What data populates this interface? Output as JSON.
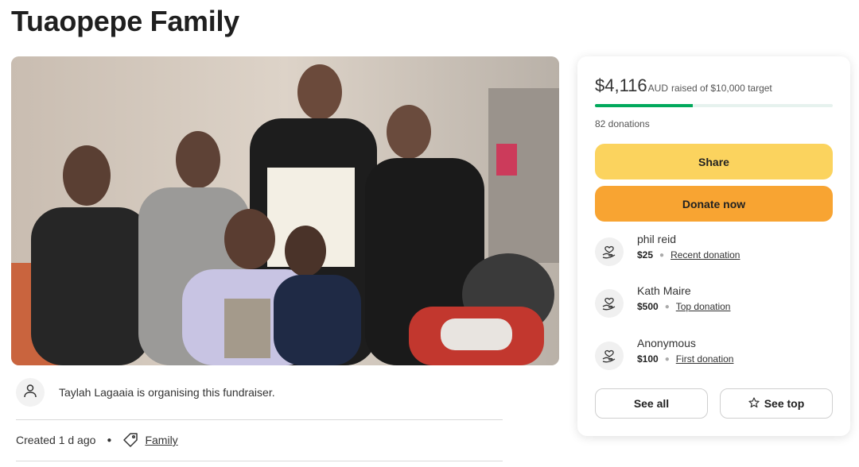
{
  "page": {
    "title": "Tuaopepe Family"
  },
  "organiser": {
    "text": "Taylah Lagaaia is organising this fundraiser."
  },
  "meta": {
    "created": "Created 1 d ago",
    "category": "Family"
  },
  "card": {
    "amount": "$4,116",
    "currency": "AUD",
    "target_text": "raised of $10,000 target",
    "progress_fraction": 0.41,
    "donations_count": "82 donations",
    "share_label": "Share",
    "donate_label": "Donate now",
    "donors": [
      {
        "name": "phil reid",
        "amount": "$25",
        "type": "Recent donation"
      },
      {
        "name": "Kath Maire",
        "amount": "$500",
        "type": "Top donation"
      },
      {
        "name": "Anonymous",
        "amount": "$100",
        "type": "First donation"
      }
    ],
    "see_all_label": "See all",
    "see_top_label": "See top"
  },
  "colors": {
    "progress": "#02a95c",
    "share_button": "#fbd35e",
    "donate_button": "#f8a432"
  },
  "icons": [
    "user-icon",
    "tag-icon",
    "heart-hand-icon",
    "star-icon"
  ]
}
